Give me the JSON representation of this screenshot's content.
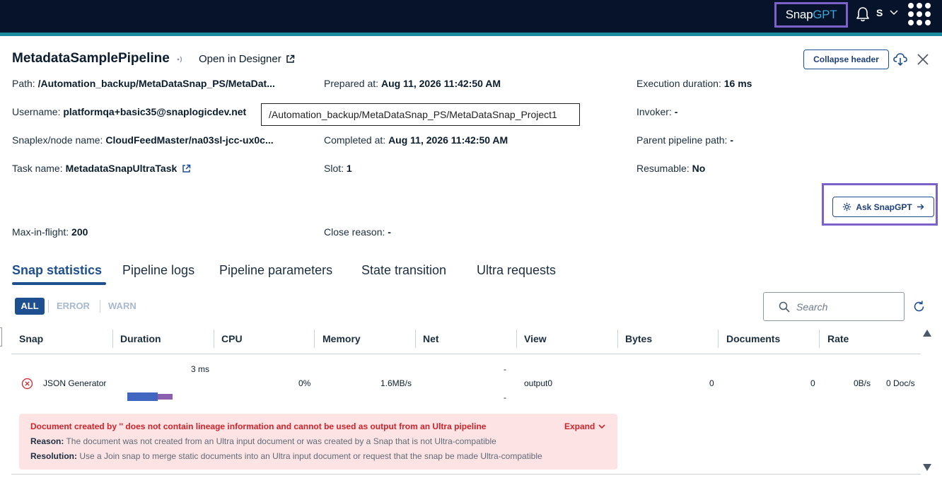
{
  "topbar": {
    "logo_snap": "Snap",
    "logo_gpt": "GPT",
    "user_initial": "S"
  },
  "header": {
    "title": "MetadataSamplePipeline",
    "open_designer": "Open in Designer",
    "collapse_label": "Collapse header",
    "fields": {
      "path": {
        "label": "Path:",
        "value": "/Automation_backup/MetaDataSnap_PS/MetaDat..."
      },
      "prepared_at": {
        "label": "Prepared at:",
        "value": "Aug 11, 2026 11:42:50 AM"
      },
      "execution_duration": {
        "label": "Execution duration:",
        "value": "16 ms"
      },
      "username": {
        "label": "Username:",
        "value": "platformqa+basic35@snaplogicdev.net"
      },
      "invoker": {
        "label": "Invoker:",
        "value": "-"
      },
      "snaplex": {
        "label": "Snaplex/node name:",
        "value": "CloudFeedMaster/na03sl-jcc-ux0c..."
      },
      "completed_at": {
        "label": "Completed at:",
        "value": "Aug 11, 2026 11:42:50 AM"
      },
      "parent_path": {
        "label": "Parent pipeline path:",
        "value": "-"
      },
      "task_name": {
        "label": "Task name:",
        "value": "MetadataSnapUltraTask"
      },
      "slot": {
        "label": "Slot:",
        "value": "1"
      },
      "resumable": {
        "label": "Resumable:",
        "value": "No"
      },
      "max_in_flight": {
        "label": "Max-in-flight:",
        "value": "200"
      },
      "close_reason": {
        "label": "Close reason:",
        "value": "-"
      }
    },
    "path_tooltip": "/Automation_backup/MetaDataSnap_PS/MetaDataSnap_Project1",
    "ask_snapgpt": "Ask SnapGPT"
  },
  "tabs": [
    {
      "label": "Snap statistics",
      "active": true
    },
    {
      "label": "Pipeline logs"
    },
    {
      "label": "Pipeline parameters"
    },
    {
      "label": "State transition"
    },
    {
      "label": "Ultra requests"
    }
  ],
  "filters": {
    "all": "ALL",
    "error": "ERROR",
    "warn": "WARN"
  },
  "search": {
    "placeholder": "Search"
  },
  "table": {
    "columns": [
      "Snap",
      "Duration",
      "CPU",
      "Memory",
      "Net",
      "View",
      "Bytes",
      "Documents",
      "Rate"
    ],
    "rows": [
      {
        "snap": "JSON Generator",
        "duration": "3 ms",
        "cpu": "0%",
        "memory": "1.6MB/s",
        "net_top": "-",
        "net_bottom": "-",
        "view": "output0",
        "bytes": "0",
        "documents": "0",
        "rate_bytes": "0B/s",
        "rate_docs": "0 Doc/s"
      }
    ]
  },
  "error": {
    "title": "Document created by '' does not contain lineage information and cannot be used as output from an Ultra pipeline",
    "expand": "Expand",
    "reason_label": "Reason:",
    "reason": "The document was not created from an Ultra input document or was created by a Snap that is not Ultra-compatible",
    "resolution_label": "Resolution:",
    "resolution": "Use a Join snap to merge static documents into an Ultra input document or request that the snap be made Ultra-compatible"
  },
  "colors": {
    "topbar": "#07132b",
    "accent_teal": "#1a8a9e",
    "primary": "#1d4f91",
    "error": "#d0232b",
    "error_bg": "#fde3e3",
    "highlight": "#7b61c9"
  }
}
